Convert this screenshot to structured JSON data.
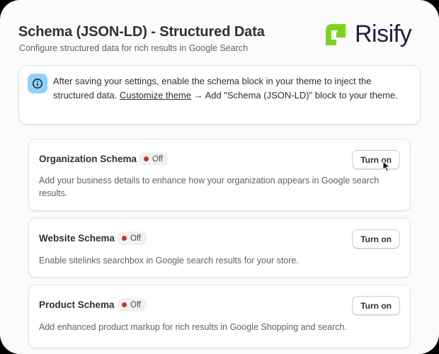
{
  "header": {
    "title": "Schema (JSON-LD) - Structured Data",
    "subtitle": "Configure structured data for rich results in Google Search"
  },
  "logo": {
    "text": "Risify",
    "color": "#7ed321"
  },
  "banner": {
    "icon": "info-icon",
    "text_before": "After saving your settings, enable the schema block in your theme to inject the structured data. ",
    "link": "Customize theme",
    "text_after": " → Add \"Schema (JSON-LD)\" block to your theme."
  },
  "schemas": [
    {
      "title": "Organization Schema",
      "status": "Off",
      "button": "Turn on",
      "description": "Add your business details to enhance how your organization appears in Google search results."
    },
    {
      "title": "Website Schema",
      "status": "Off",
      "button": "Turn on",
      "description": "Enable sitelinks searchbox in Google search results for your store."
    },
    {
      "title": "Product Schema",
      "status": "Off",
      "button": "Turn on",
      "description": "Add enhanced product markup for rich results in Google Shopping and search."
    }
  ]
}
